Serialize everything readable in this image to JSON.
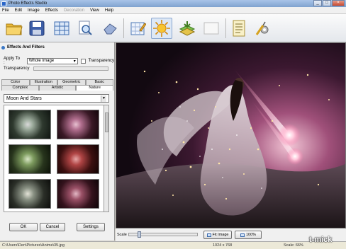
{
  "window": {
    "title": "Photo Effects Studio",
    "controls": [
      "_",
      "□",
      "×"
    ]
  },
  "menu": [
    "File",
    "Edit",
    "Image",
    "Effects",
    "Decoration",
    "View",
    "Help"
  ],
  "menu_disabled": [
    "Decoration"
  ],
  "toolbar": {
    "buttons": [
      {
        "name": "open-icon"
      },
      {
        "name": "save-icon"
      },
      {
        "name": "batch-grid-icon"
      },
      {
        "name": "magnifier-icon"
      },
      {
        "name": "eraser-icon"
      },
      {
        "name": "edit-grid-icon"
      },
      {
        "name": "effects-sun-icon"
      },
      {
        "name": "layers-icon"
      },
      {
        "name": "blank-frame-icon"
      },
      {
        "name": "document-icon"
      },
      {
        "name": "settings-tools-icon"
      }
    ],
    "active_index": 6
  },
  "panel": {
    "title": "Effects And Filters",
    "apply_to_label": "Apply To :",
    "apply_to_value": "Whole Image",
    "transparency_check_label": "Transparency",
    "transparency_label": "Transparency",
    "transparency_value": 0,
    "tabs_row1": [
      "Color",
      "Illustration",
      "Geometric",
      "Basic"
    ],
    "tabs_row2": [
      "Complex",
      "Artistic",
      "Nature"
    ],
    "selected_tab": "Nature",
    "effect_combo": "Moon And Stars",
    "ok_label": "OK",
    "cancel_label": "Cancel",
    "settings_label": "Settings"
  },
  "bottom": {
    "scale_label": "Scale",
    "fit_label": "Fit Image",
    "zoom_label": "100%"
  },
  "status": {
    "path": "C:\\Users\\Den\\Pictures\\Anime\\35.jpg",
    "dimensions": "1024 x 768",
    "scale": "Scale: 66%"
  },
  "watermark": "t-mick",
  "colors": {
    "accent": "#3b78c6",
    "titlebar": "#8fb0dc",
    "canvas_bg": "#2b2b33"
  }
}
